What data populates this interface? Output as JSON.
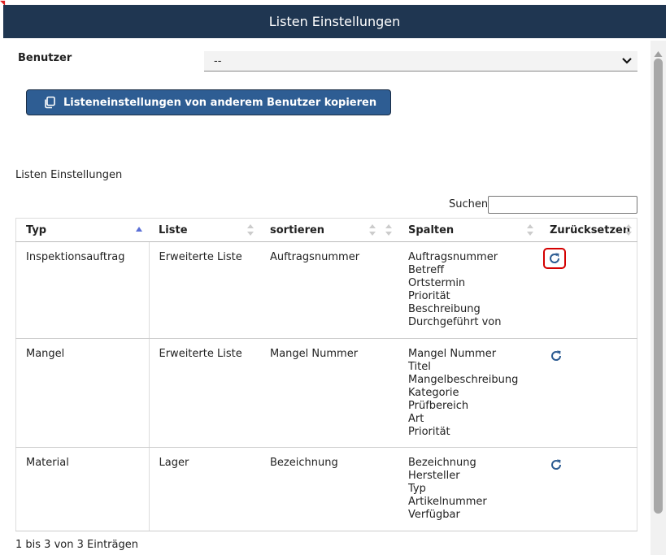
{
  "dialog": {
    "title": "Listen Einstellungen"
  },
  "user": {
    "label": "Benutzer",
    "selected": "--"
  },
  "copy_button": {
    "label": "Listeneinstellungen von anderem Benutzer kopieren"
  },
  "section": {
    "title": "Listen Einstellungen"
  },
  "search": {
    "label": "Suchen",
    "value": ""
  },
  "table": {
    "headers": [
      "Typ",
      "Liste",
      "sortieren",
      "Spalten",
      "Zurücksetzen"
    ],
    "rows": [
      {
        "typ": "Inspektionsauftrag",
        "liste": "Erweiterte Liste",
        "sortieren": "Auftragsnummer",
        "spalten": [
          "Auftragsnummer",
          "Betreff",
          "Ortstermin",
          "Priorität",
          "Beschreibung",
          "Durchgeführt von"
        ]
      },
      {
        "typ": "Mangel",
        "liste": "Erweiterte Liste",
        "sortieren": "Mangel Nummer",
        "spalten": [
          "Mangel Nummer",
          "Titel",
          "Mangelbeschreibung",
          "Kategorie",
          "Prüfbereich",
          "Art",
          "Priorität"
        ]
      },
      {
        "typ": "Material",
        "liste": "Lager",
        "sortieren": "Bezeichnung",
        "spalten": [
          "Bezeichnung",
          "Hersteller",
          "Typ",
          "Artikelnummer",
          "Verfügbar"
        ]
      }
    ]
  },
  "footer": {
    "info": "1 bis 3 von 3 Einträgen"
  },
  "icons": {
    "reset": "refresh-icon",
    "copy": "copy-icon",
    "dropdown": "chevron-down-icon"
  },
  "colors": {
    "titlebar": "#1f3651",
    "button": "#2e5d93",
    "icon": "#2e5d93",
    "highlight": "#d40000"
  }
}
